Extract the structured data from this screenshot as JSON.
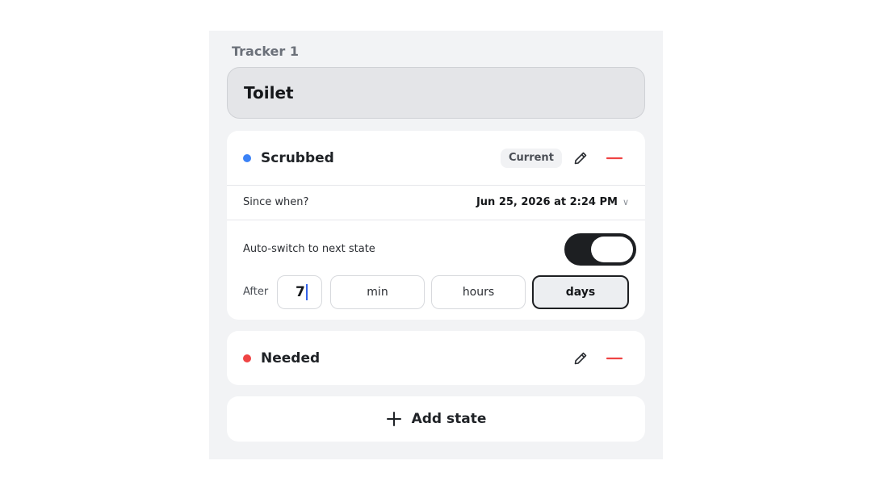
{
  "tracker": {
    "label": "Tracker 1",
    "name": "Toilet"
  },
  "states": [
    {
      "name": "Scrubbed",
      "dot_color": "#3b82f6",
      "badge": "Current",
      "since_label": "Since when?",
      "since_value": "Jun 25, 2026 at 2:24 PM",
      "auto_switch_label": "Auto-switch to next state",
      "auto_switch_on": true,
      "after_label": "After",
      "after_value": "7",
      "units": [
        "min",
        "hours",
        "days"
      ],
      "selected_unit": "days"
    },
    {
      "name": "Needed",
      "dot_color": "#ef4444"
    }
  ],
  "add_state": {
    "icon": "plus-icon",
    "label": "Add state"
  },
  "colors": {
    "danger": "#ef4444",
    "panel_bg": "#f2f3f5",
    "toggle_on": "#1d1f22"
  }
}
